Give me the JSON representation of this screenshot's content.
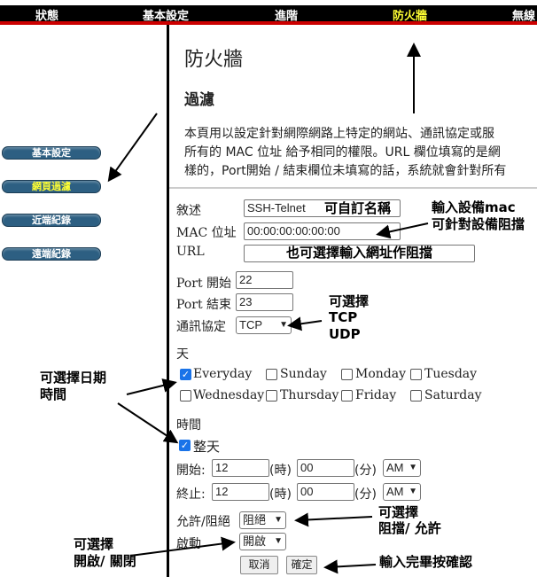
{
  "topnav": {
    "items": [
      "狀態",
      "基本設定",
      "進階",
      "防火牆",
      "無線"
    ],
    "active": "防火牆"
  },
  "sidebar": {
    "items": [
      "基本設定",
      "網頁過濾",
      "近端紀錄",
      "遠端紀錄"
    ],
    "active": "網頁過濾"
  },
  "page": {
    "title": "防火牆",
    "subtitle": "過濾",
    "desc": [
      "本頁用以設定針對網際網路上特定的網站、通訊協定或服",
      "所有的 MAC 位址 給予相同的權限。URL 欄位填寫的是網",
      "樣的，Port開始 / 結束欄位未填寫的話，系統就會針對所有"
    ]
  },
  "form": {
    "desc_label": "敘述",
    "desc_value": "SSH-Telnet",
    "mac_label": "MAC 位址",
    "mac_value": "00:00:00:00:00:00",
    "url_label": "URL",
    "url_value": "",
    "port_start_label": "Port 開始",
    "port_start": "22",
    "port_end_label": "Port 結束",
    "port_end": "23",
    "protocol_label": "通訊協定",
    "protocol": "TCP",
    "day_label": "天",
    "days": [
      {
        "label": "Everyday",
        "checked": true
      },
      {
        "label": "Sunday",
        "checked": false
      },
      {
        "label": "Monday",
        "checked": false
      },
      {
        "label": "Tuesday",
        "checked": false
      },
      {
        "label": "Wednesday",
        "checked": false
      },
      {
        "label": "Thursday",
        "checked": false
      },
      {
        "label": "Friday",
        "checked": false
      },
      {
        "label": "Saturday",
        "checked": false
      }
    ],
    "time_label": "時間",
    "allday_label": "整天",
    "allday_checked": true,
    "start_label": "開始:",
    "end_label": "終止:",
    "hour_unit": "(時)",
    "min_unit": "(分)",
    "start_hour": "12",
    "start_min": "00",
    "start_ampm": "AM",
    "end_hour": "12",
    "end_min": "00",
    "end_ampm": "AM",
    "action_label": "允許/阻絕",
    "action": "阻絕",
    "enable_label": "啟動",
    "enable": "開啟",
    "cancel": "取消",
    "confirm": "確定"
  },
  "annotations": {
    "custom_name": "可自訂名稱",
    "mac1": "輸入設備mac",
    "mac2": "可針對設備阻擋",
    "url": "也可選擇輸入網址作阻擋",
    "proto1": "可選擇",
    "proto2": "TCP",
    "proto3": "UDP",
    "date1": "可選擇日期",
    "date2": "時間",
    "action1": "可選擇",
    "action2": "阻擋/ 允許",
    "enable1": "可選擇",
    "enable2": "開啟/ 關閉",
    "confirm": "輸入完畢按確認"
  }
}
